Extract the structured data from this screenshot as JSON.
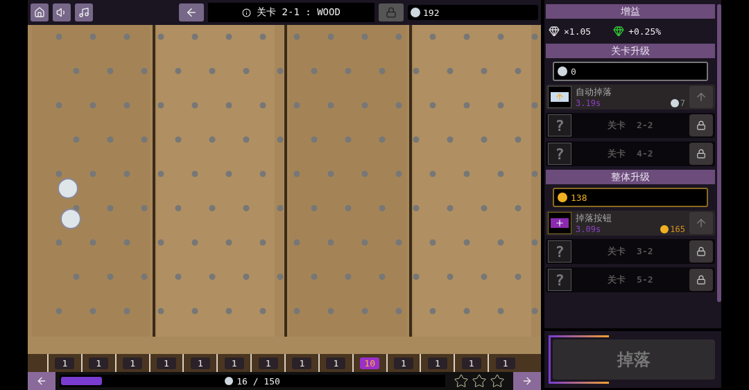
{
  "top_bar": {
    "title": "关卡 2-1 : WOOD",
    "coins": "192"
  },
  "board": {
    "slots": [
      {
        "label": "1",
        "highlighted": false
      },
      {
        "label": "1",
        "highlighted": false
      },
      {
        "label": "1",
        "highlighted": false
      },
      {
        "label": "1",
        "highlighted": false
      },
      {
        "label": "1",
        "highlighted": false
      },
      {
        "label": "1",
        "highlighted": false
      },
      {
        "label": "1",
        "highlighted": false
      },
      {
        "label": "1",
        "highlighted": false
      },
      {
        "label": "1",
        "highlighted": false
      },
      {
        "label": "10",
        "highlighted": true
      },
      {
        "label": "1",
        "highlighted": false
      },
      {
        "label": "1",
        "highlighted": false
      },
      {
        "label": "1",
        "highlighted": false
      },
      {
        "label": "1",
        "highlighted": false
      }
    ]
  },
  "bottom_bar": {
    "level": 0.107,
    "reading": "16 / 150",
    "stars": 0
  },
  "panel": {
    "sections": [
      {
        "kind": "bonus",
        "title": "增益",
        "bonuses": [
          "×1.05",
          "+0.25%"
        ]
      },
      {
        "kind": "upgrades",
        "title": "关卡升级",
        "color": "#cfd8df",
        "balance": "0",
        "items": [
          {
            "kind": "upgrade",
            "name": "自动掉落",
            "value": "3.19s",
            "cost": "7"
          },
          {
            "kind": "locked",
            "mark": "?",
            "name": "关卡  2-2"
          },
          {
            "kind": "locked",
            "mark": "?",
            "name": "关卡  4-2"
          }
        ]
      },
      {
        "kind": "upgrades",
        "title": "整体升级",
        "color": "#f0b020",
        "balance": "138",
        "items": [
          {
            "kind": "upgrade",
            "name": "掉落按钮",
            "value": "3.09s",
            "cost": "165"
          },
          {
            "kind": "locked",
            "mark": "?",
            "name": "关卡  3-2"
          },
          {
            "kind": "locked",
            "mark": "?",
            "name": "关卡  5-2"
          }
        ]
      }
    ]
  },
  "drop_button": {
    "label": "掉落"
  }
}
